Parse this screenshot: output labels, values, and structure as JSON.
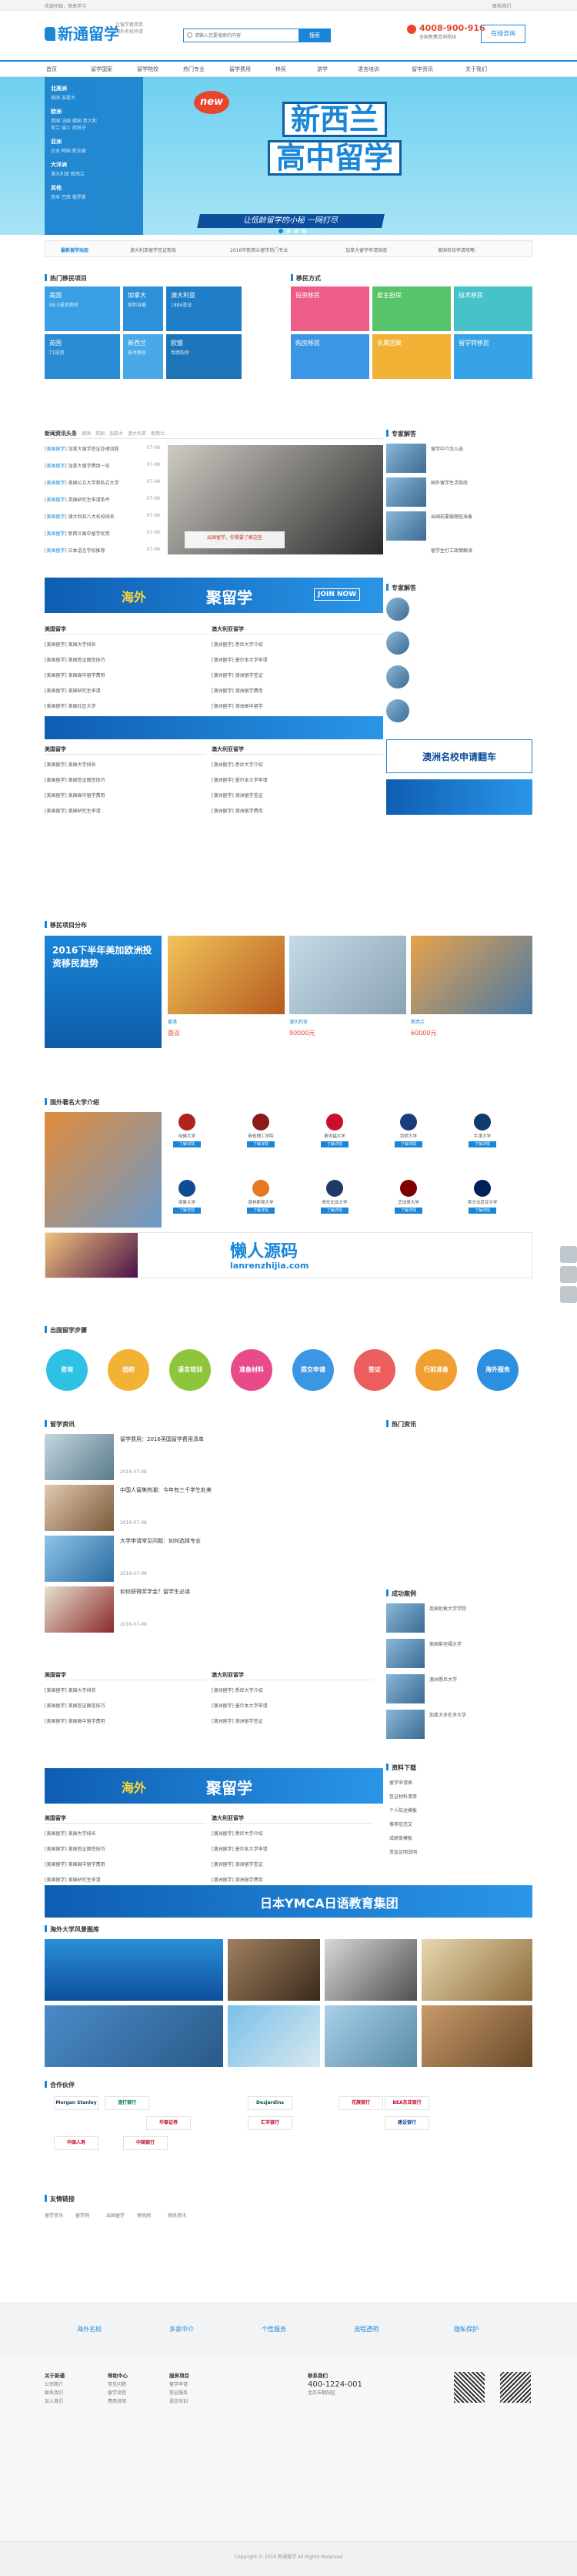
{
  "topbar": {
    "left": "欢迎光临，快来学习",
    "right": "联系我们"
  },
  "header": {
    "logo": "新通留学",
    "slogan": "让留学更简单\n国外名校申请",
    "search_placeholder": "请输入您要搜索的内容",
    "search_btn": "搜索",
    "hotline": "4008-900-916",
    "hotline_label": "全国免费咨询热线",
    "online": "在线咨询"
  },
  "nav": [
    "首页",
    "留学国家",
    "留学院校",
    "热门专业",
    "留学费用",
    "移民",
    "游学",
    "语言培训",
    "留学资讯",
    "关于我们"
  ],
  "hero": {
    "badge": "new",
    "title1": "新西兰",
    "title2": "高中留学",
    "subtitle": "让低龄留学的小秘 一网打尽",
    "side": [
      {
        "h": "北美洲",
        "items": [
          "美国 加拿大"
        ]
      },
      {
        "h": "欧洲",
        "items": [
          "英国 法国 德国 意大利",
          "荷兰 瑞士 西班牙"
        ]
      },
      {
        "h": "亚洲",
        "items": [
          "日本 韩国 新加坡"
        ]
      },
      {
        "h": "大洋洲",
        "items": [
          "澳大利亚 新西兰"
        ]
      },
      {
        "h": "其他",
        "items": [
          "南非 巴西 俄罗斯"
        ]
      }
    ]
  },
  "newsbar": {
    "label": "最新留学动态",
    "items": [
      "澳大利亚留学签证新政",
      "2016年新西兰留学热门专业",
      "加拿大留学申请指南",
      "美国名校申请攻略"
    ]
  },
  "hot": {
    "title": "热门移民项目",
    "right_title": "移民方式",
    "tiles": [
      {
        "t": "美国",
        "s": "EB-5投资移民"
      },
      {
        "t": "加拿大",
        "s": "联邦自雇"
      },
      {
        "t": "澳大利亚",
        "s": "188A签证"
      },
      {
        "t": "英国",
        "s": "T1投资"
      },
      {
        "t": "新西兰",
        "s": "技术移民"
      },
      {
        "t": "欧盟",
        "s": "希腊购房"
      }
    ],
    "ways": [
      "投资移民",
      "雇主担保",
      "技术移民",
      "购房移民",
      "亲属团聚",
      "留学转移民"
    ]
  },
  "studyNews": {
    "title": "新闻资讯头条",
    "tabs": [
      "美国",
      "英国",
      "加拿大",
      "澳大利亚",
      "新西兰",
      "日本",
      "韩国"
    ],
    "items": [
      {
        "tag": "[美国留学]",
        "t": "加拿大留学签证办理流程",
        "d": "07-08"
      },
      {
        "tag": "[美国留学]",
        "t": "加拿大留学费用一览",
        "d": "07-08"
      },
      {
        "tag": "[美国留学]",
        "t": "美国公立大学和私立大学",
        "d": "07-08"
      },
      {
        "tag": "[美国留学]",
        "t": "英国研究生申请条件",
        "d": "07-08"
      },
      {
        "tag": "[美国留学]",
        "t": "澳大利亚八大名校排名",
        "d": "07-08"
      },
      {
        "tag": "[美国留学]",
        "t": "新西兰高中留学优势",
        "d": "07-08"
      },
      {
        "tag": "[美国留学]",
        "t": "日本语言学校推荐",
        "d": "07-08"
      }
    ],
    "img_caption": "出国留学，你需要了解这些"
  },
  "expert": {
    "title": "专家解答",
    "items": [
      "留学中介怎么选",
      "国外留学生活指南",
      "出国前要做哪些准备",
      "留学生打工政策解读"
    ]
  },
  "banner1": {
    "t1": "海外",
    "t2": "聚留学",
    "t3": "JOIN NOW"
  },
  "usa": {
    "title": "美国留学",
    "items": [
      "[美国留学] 美国大学排名",
      "[美国留学] 美国签证面签技巧",
      "[美国留学] 美国高中留学费用",
      "[美国留学] 美国研究生申请",
      "[美国留学] 美国社区大学"
    ]
  },
  "aus": {
    "title": "澳大利亚留学",
    "items": [
      "[澳洲留学] 悉尼大学介绍",
      "[澳洲留学] 墨尔本大学申请",
      "[澳洲留学] 澳洲留学签证",
      "[澳洲留学] 澳洲留学费用",
      "[澳洲留学] 澳洲高中留学"
    ]
  },
  "banner2": {
    "t": "澳洲名校申请翻车"
  },
  "mig": {
    "title": "移民项目分布",
    "cards": [
      {
        "t": "香港",
        "p": "面议"
      },
      {
        "t": "澳大利亚",
        "p": "90000元"
      },
      {
        "t": "新西兰",
        "p": "60000元"
      }
    ],
    "tab": "2016下半年美加欧洲投资移民趋势"
  },
  "schools": {
    "title": "国外著名大学介绍",
    "names": [
      "哈佛大学",
      "麻省理工学院",
      "斯坦福大学",
      "剑桥大学",
      "牛津大学",
      "耶鲁大学",
      "普林斯顿大学",
      "哥伦比亚大学",
      "芝加哥大学",
      "宾夕法尼亚大学"
    ],
    "btn": "了解详情"
  },
  "lanren": {
    "t1": "懒人源码",
    "t2": "lanrenzhijia.com"
  },
  "steps": {
    "title": "出国留学步骤",
    "items": [
      "咨询",
      "选校",
      "语言培训",
      "准备材料",
      "提交申请",
      "签证",
      "行前准备",
      "海外服务"
    ]
  },
  "study": {
    "title": "留学资讯",
    "right": "热门资讯",
    "items": [
      {
        "t": "留学费用：2016英国留学费用清单",
        "d": "2016-07-08"
      },
      {
        "t": "中国人留美热潮：今年有三千学生赴美",
        "d": "2016-07-08"
      },
      {
        "t": "大学申请常见问题：如何选择专业",
        "d": "2016-07-08"
      },
      {
        "t": "如何获得奖学金？留学生必读",
        "d": "2016-07-08"
      }
    ]
  },
  "cases": {
    "title": "成功案例",
    "items": [
      "英国伦敦大学学院",
      "美国斯坦福大学",
      "澳洲悉尼大学",
      "加拿大多伦多大学"
    ]
  },
  "downloads": {
    "title": "资料下载",
    "items": [
      "留学申请表",
      "签证材料清单",
      "个人陈述模板",
      "推荐信范文",
      "成绩单模板",
      "资金证明说明"
    ]
  },
  "ymca": {
    "t": "日本YMCA日语教育集团"
  },
  "gallery": {
    "title": "海外大学风景图库"
  },
  "partners": {
    "title": "合作伙伴",
    "items": [
      "Morgan Stanley",
      "渣打银行",
      "Desjardins",
      "华泰证券",
      "花旗银行",
      "汇丰银行",
      "BEA东亚银行",
      "建设银行",
      "中国人寿",
      "中国银行"
    ]
  },
  "links": {
    "title": "友情链接",
    "items": [
      "留学资讯",
      "留学网",
      "出国留学",
      "移民网",
      "移民资讯"
    ]
  },
  "footer": {
    "features": [
      "海外名校",
      "多家中介",
      "个性服务",
      "流程透明",
      "隐私保护"
    ],
    "cols": [
      {
        "h": "关于新通",
        "items": [
          "公司简介",
          "联系我们",
          "加入我们"
        ]
      },
      {
        "h": "帮助中心",
        "items": [
          "常见问题",
          "留学流程",
          "费用说明"
        ]
      },
      {
        "h": "服务项目",
        "items": [
          "留学申请",
          "签证服务",
          "语言培训"
        ]
      },
      {
        "h": "联系我们",
        "items": [
          "400-1224-001",
          "北京市朝阳区"
        ]
      }
    ],
    "copyright": "Copyright © 2016 新通留学 All Rights Reserved"
  },
  "colors": {
    "blue": "#1a86d8",
    "red": "#e8452d"
  }
}
